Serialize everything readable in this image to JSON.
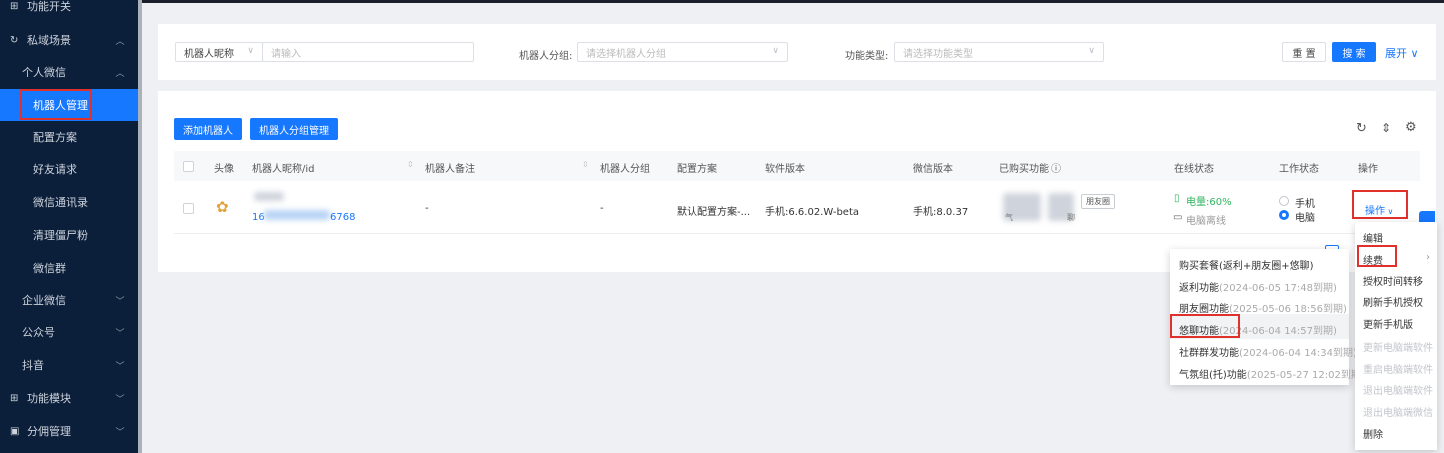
{
  "sidebar": {
    "items": [
      {
        "label": "功能开关",
        "icon": "grid-icon"
      },
      {
        "label": "私域场景",
        "icon": "sync-icon"
      },
      {
        "label": "个人微信"
      },
      {
        "label": "机器人管理"
      },
      {
        "label": "配置方案"
      },
      {
        "label": "好友请求"
      },
      {
        "label": "微信通讯录"
      },
      {
        "label": "清理僵尸粉"
      },
      {
        "label": "微信群"
      },
      {
        "label": "企业微信"
      },
      {
        "label": "公众号"
      },
      {
        "label": "抖音"
      },
      {
        "label": "功能模块",
        "icon": "grid-icon"
      },
      {
        "label": "分佣管理",
        "icon": "box-icon"
      }
    ]
  },
  "filters": {
    "nickname_select": "机器人昵称",
    "nickname_placeholder": "请输入",
    "group_label": "机器人分组:",
    "group_placeholder": "请选择机器人分组",
    "type_label": "功能类型:",
    "type_placeholder": "请选择功能类型",
    "reset": "重 置",
    "search": "搜 索",
    "expand": "展开"
  },
  "toolbar": {
    "add_robot": "添加机器人",
    "group_manage": "机器人分组管理"
  },
  "table": {
    "headers": [
      "头像",
      "机器人昵称/id",
      "机器人备注",
      "机器人分组",
      "配置方案",
      "软件版本",
      "微信版本",
      "已购买功能",
      "在线状态",
      "工作状态",
      "操作"
    ],
    "row": {
      "id_prefix": "16",
      "id_suffix": "6768",
      "remark": "-",
      "group": "-",
      "config": "默认配置方案-...",
      "software": "手机:6.6.02.W-beta",
      "wechat": "手机:8.0.37",
      "feature_tag": "朋友圈",
      "feature_fragment_1": "气",
      "feature_fragment_2": "聊",
      "battery": "电量:60%",
      "pc_status": "电脑离线",
      "radio_phone": "手机",
      "radio_pc": "电脑",
      "op": "操作"
    }
  },
  "renew_submenu": [
    {
      "name": "购买套餐(返利+朋友圈+悠聊)",
      "detail": ""
    },
    {
      "name": "返利功能",
      "detail": "(2024-06-05 17:48到期)"
    },
    {
      "name": "朋友圈功能",
      "detail": "(2025-05-06 18:56到期)"
    },
    {
      "name": "悠聊功能",
      "detail": "(2024-06-04 14:57到期)"
    },
    {
      "name": "社群群发功能",
      "detail": "(2024-06-04 14:34到期)"
    },
    {
      "name": "气氛组(托)功能",
      "detail": "(2025-05-27 12:02到期)"
    }
  ],
  "op_menu": [
    {
      "label": "编辑",
      "disabled": false
    },
    {
      "label": "续费",
      "disabled": false
    },
    {
      "label": "授权时间转移",
      "disabled": false
    },
    {
      "label": "刷新手机授权",
      "disabled": false
    },
    {
      "label": "更新手机版",
      "disabled": false
    },
    {
      "label": "更新电脑端软件",
      "disabled": true
    },
    {
      "label": "重启电脑端软件",
      "disabled": true
    },
    {
      "label": "退出电脑端软件",
      "disabled": true
    },
    {
      "label": "退出电脑端微信",
      "disabled": true
    },
    {
      "label": "删除",
      "disabled": false
    }
  ],
  "colors": {
    "accent": "#1677ff",
    "sidebar": "#0c1f3a",
    "highlight": "#e0312c",
    "online": "#2db55d"
  }
}
